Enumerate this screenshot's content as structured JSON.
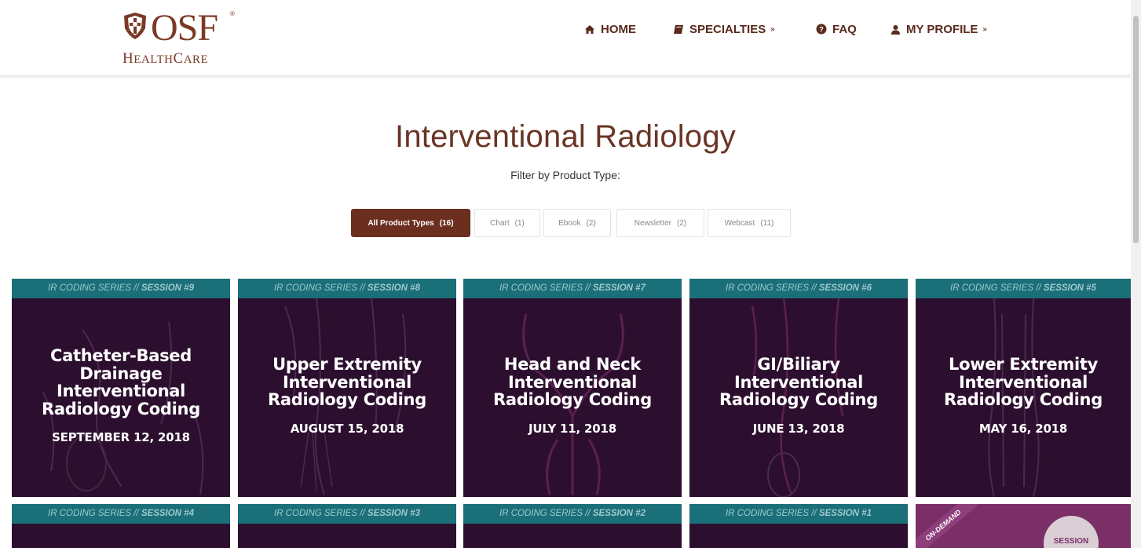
{
  "header": {
    "logo": {
      "main": "OSF",
      "registered": "®",
      "sub_first": "H",
      "sub_rest": "EALTH",
      "sub_c": "C",
      "sub_end": "ARE"
    },
    "nav": [
      {
        "label": "HOME",
        "icon": "home-icon"
      },
      {
        "label": "SPECIALTIES",
        "icon": "book-icon",
        "chevron": "»"
      },
      {
        "label": "FAQ",
        "icon": "question-circle-icon"
      },
      {
        "label": "MY PROFILE",
        "icon": "user-icon",
        "chevron": "»"
      }
    ]
  },
  "page": {
    "title": "Interventional Radiology",
    "filter_label": "Filter by Product Type:"
  },
  "filters": [
    {
      "label": "All Product Types",
      "count": "(16)",
      "active": true
    },
    {
      "label": "Chart",
      "count": "(1)",
      "active": false
    },
    {
      "label": "Ebook",
      "count": "(2)",
      "active": false
    },
    {
      "label": "Newsletter",
      "count": "(2)",
      "active": false
    },
    {
      "label": "Webcast",
      "count": "(11)",
      "active": false
    }
  ],
  "cards": [
    {
      "series": "IR CODING SERIES // ",
      "session": "SESSION #9",
      "title": "Catheter-Based Drainage Interventional Radiology Coding",
      "date": "SEPTEMBER 12, 2018"
    },
    {
      "series": "IR CODING SERIES // ",
      "session": "SESSION #8",
      "title": "Upper Extremity Interventional Radiology Coding",
      "date": "AUGUST 15, 2018"
    },
    {
      "series": "IR CODING SERIES // ",
      "session": "SESSION #7",
      "title": "Head and Neck Interventional Radiology Coding",
      "date": "JULY 11, 2018"
    },
    {
      "series": "IR CODING SERIES // ",
      "session": "SESSION #6",
      "title": "GI/Biliary Interventional Radiology Coding",
      "date": "JUNE 13, 2018"
    },
    {
      "series": "IR CODING SERIES // ",
      "session": "SESSION #5",
      "title": "Lower Extremity Interventional Radiology Coding",
      "date": "MAY 16, 2018"
    }
  ],
  "cards_row2": [
    {
      "series": "IR CODING SERIES // ",
      "session": "SESSION #4"
    },
    {
      "series": "IR CODING SERIES // ",
      "session": "SESSION #3"
    },
    {
      "series": "IR CODING SERIES // ",
      "session": "SESSION #2"
    },
    {
      "series": "IR CODING SERIES // ",
      "session": "SESSION #1"
    }
  ],
  "ondemand": {
    "ribbon": "ON-DEMAND",
    "badge": "SESSION"
  },
  "colors": {
    "brand": "#6b2e1f",
    "card_bg": "#2c0f2e",
    "band": "#1a6f78",
    "band_text": "#9ec9cf",
    "ondemand": "#7a2f67"
  }
}
